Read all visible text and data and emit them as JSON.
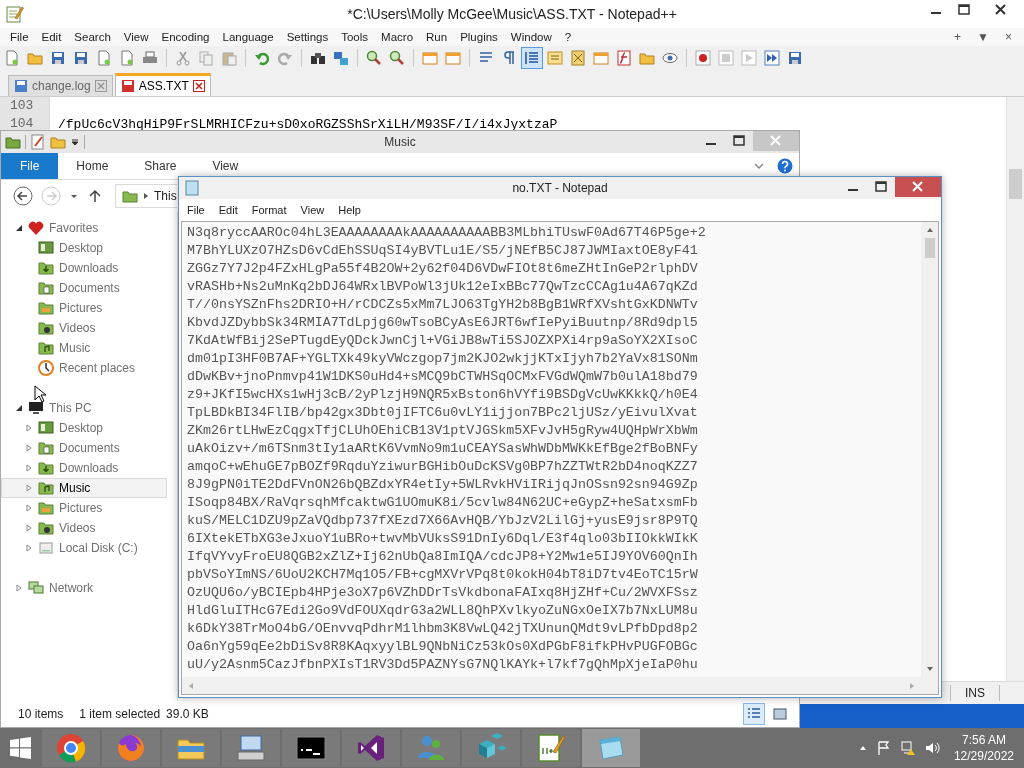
{
  "notepad_pp": {
    "title": "*C:\\Users\\Molly McGee\\Music\\ASS.TXT - Notepad++",
    "menu": [
      "File",
      "Edit",
      "Search",
      "View",
      "Encoding",
      "Language",
      "Settings",
      "Tools",
      "Macro",
      "Run",
      "Plugins",
      "Window",
      "?"
    ],
    "menu_controls": [
      "+",
      "▼",
      "×"
    ],
    "tabs": [
      {
        "label": "change.log",
        "selected": false,
        "modified": false
      },
      {
        "label": "ASS.TXT",
        "selected": true,
        "modified": true
      }
    ],
    "lines": [
      {
        "number": "103"
      },
      {
        "number": "104",
        "text": "/fpUc6cV3hqHiP9FrSLMRHICFzu+sD0xoRGZSShSrXiLH/M93SF/I/i4xJyxtzaP"
      }
    ],
    "status_bar": {
      "mode": "INS"
    }
  },
  "explorer": {
    "title": "Music",
    "ribbon_tabs": [
      {
        "label": "File",
        "selected": true
      },
      {
        "label": "Home",
        "selected": false
      },
      {
        "label": "Share",
        "selected": false
      },
      {
        "label": "View",
        "selected": false
      }
    ],
    "address": "This",
    "sidebar": [
      {
        "label": "Favorites",
        "kind": "favorites",
        "expanded": true,
        "selected": false,
        "children": [
          {
            "label": "Desktop",
            "kind": "desktop",
            "selected": false
          },
          {
            "label": "Downloads",
            "kind": "downloads",
            "selected": false
          },
          {
            "label": "Documents",
            "kind": "documents",
            "selected": false
          },
          {
            "label": "Pictures",
            "kind": "pictures",
            "selected": false
          },
          {
            "label": "Videos",
            "kind": "videos",
            "selected": false
          },
          {
            "label": "Music",
            "kind": "music",
            "selected": false
          },
          {
            "label": "Recent places",
            "kind": "recent",
            "selected": false
          }
        ]
      },
      {
        "label": "This PC",
        "kind": "pc",
        "expanded": true,
        "selected": false,
        "children": [
          {
            "label": "Desktop",
            "kind": "desktop",
            "expanded": false,
            "selected": false
          },
          {
            "label": "Documents",
            "kind": "documents",
            "expanded": false,
            "selected": false
          },
          {
            "label": "Downloads",
            "kind": "downloads",
            "expanded": false,
            "selected": false
          },
          {
            "label": "Music",
            "kind": "music",
            "expanded": false,
            "selected": true
          },
          {
            "label": "Pictures",
            "kind": "pictures",
            "expanded": false,
            "selected": false
          },
          {
            "label": "Videos",
            "kind": "videos",
            "expanded": false,
            "selected": false
          },
          {
            "label": "Local Disk (C:)",
            "kind": "disk",
            "expanded": false,
            "selected": false
          }
        ]
      },
      {
        "label": "Network",
        "kind": "network",
        "expanded": false,
        "selected": false
      }
    ],
    "status_bar": {
      "items": "10 items",
      "selected": "1 item selected",
      "size": "39.0 KB"
    },
    "views": [
      {
        "kind": "details",
        "selected": true
      },
      {
        "kind": "tiles",
        "selected": false
      }
    ]
  },
  "notepad": {
    "title": "no.TXT - Notepad",
    "menu": [
      "File",
      "Edit",
      "Format",
      "View",
      "Help"
    ],
    "lines": [
      "N3q8ryccAAROc04hL3EAAAAAAAAkAAAAAAAAAABB3MLbhiTUswF0Ad67T46P5ge+2",
      "M7BhYLUXzO7HZsD6vCdEhSSUqSI4yBVTLu1E/S5/jNEfB5CJ87JWMIaxtOE8yF41",
      "ZGGz7Y7J2p4FZxHLgPa55f4B2OW+2y62f04D6VDwFIOt8t6meZHtInGeP2rlphDV",
      "vRASHb+Ns2uMnKq2bDJ64WRxlBVPoWl3jUk12eIxBBc77QwTzcCCAg1u4A67qKZd",
      "T//0nsYSZnFhs2DRIO+H/rCDCZs5xMm7LJO63TgYH2b8BgB1WRfXVshtGxKDNWTv",
      "KbvdJZDybbSk34RMIA7TdLpjg60wTsoBCyAsE6JRT6wfIePyiBuutnp/8Rd9dpl5",
      "7KdAtWfBij2SePTugdEyQDckJwnCjl+VGiJB8wTi5SJOZXPXi4rp9aSoYX2XIsoC",
      "dm01pI3HF0B7AF+YGLTXk49kyVWczgop7jm2KJO2wkjjKTxIjyh7b2YaVx81SONm",
      "dDwKBv+jnoPnmvp41W1DKS0uHd4+sMCQ9bCTWHSqOCMxFVGdWQmW7b0ulA18bd79",
      "z9+JKfI5wcHXs1wHj3cB/2yPlzjH9NQR5xBston6hVYfi9BSDgVcUwKKkkQ/h0E4",
      "TpLBDkBI34FlIB/bp42gx3Dbt0jIFTC6u0vLY1ijjon7BPc2ljUSz/yEivulXvat",
      "ZKm26rtLHwEzCqgxTfjCLUhOEhiCB13V1ptVJGSkm5XFvJvH5gRyw4UQHpWrXbWm",
      "uAkOizv+/m6TSnm3tIy1aARtK6VvmNo9m1uCEAYSasWhWDbMWKkEfBge2fBoBNFy",
      "amqoC+wEhuGE7pBOZf9RqduYziwurBGHibOuDcKSVg0BP7hZZTWtR2bD4noqKZZ7",
      "8J9gPN0iTE2DdFVnON26bQBZdxYR4etIy+5WLRvkHViIRijqJnOSsn92sn94G9Zp",
      "ISoqp84BX/RaVqrsqhMfcaktwG1UOmuK8i/5cvlw84N62UC+eGypZ+heSatxsmFb",
      "kuS/MELC1DZU9pZaVQdbp737fXEzd7X66AvHQB/YbJzV2LilGj+yusE9jsr8P9TQ",
      "6IXtekETbXG3eJxuoY1uBRo+twvMbVUksS91DnIy6Dql/E3f4qlo03bIIOkkWIkK",
      "IfqVYvyFroEU8QGB2xZlZ+Ij62nUbQa8ImIQA/cdcJP8+Y2Mw1e5IJ9YOV60QnIh",
      "pbVSoYImNS/6UoU2KCH7Mq1O5/FB+cgMXVrVPq8t0kokH04bT8iD7tv4EoTC15rW",
      "OzUQU6o/yBCIEpb4HPje3oX7p6VZhDDrTsVkdbonaFAIxq8HjZHf+Cu/2WVXFSsz",
      "HldGluITHcG7Edi2Go9VdFOUXqdrG3a2WLL8QhPXvlkyoZuNGxOeIX7b7NxLUM8u",
      "k6DkY38TrMoO4bG/OEnvvqPdhrM1lhbm3K8VwLQ42jTXUnunQMdt9vLPfbDpd8p2",
      "Oa6nYg59qEe2bDiSv8R8KAqxyylBL9QNbNiCz53kOs0XdPGbF8ifkPHvPUGFOBGc",
      "uU/y2Asnm5CazJfbnPXIsT1RV3Dd5PAZNYsG7NQlKAYk+l7kf7gQhMpXjeIaP0hu"
    ]
  },
  "taskbar": {
    "apps": [
      {
        "active": false
      },
      {
        "active": false
      },
      {
        "active": false
      },
      {
        "active": false
      },
      {
        "active": false
      },
      {
        "active": false
      },
      {
        "active": false
      },
      {
        "active": false
      },
      {
        "active": false
      },
      {
        "active": true
      }
    ],
    "time": "7:56 AM",
    "date": "12/29/2022"
  }
}
